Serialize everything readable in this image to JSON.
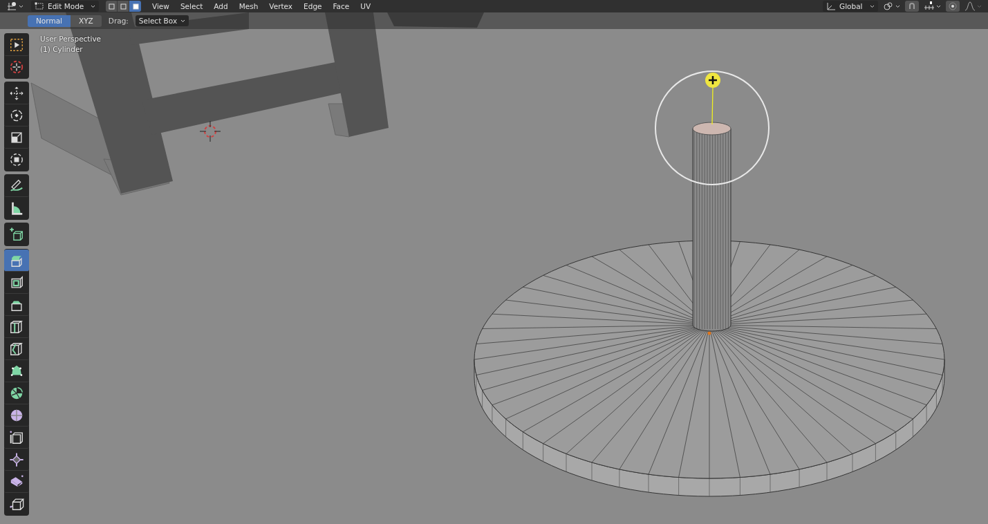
{
  "header": {
    "mode": "Edit Mode",
    "select_modes": [
      {
        "selected": false
      },
      {
        "selected": false
      },
      {
        "selected": true
      }
    ],
    "menus": [
      "View",
      "Select",
      "Add",
      "Mesh",
      "Vertex",
      "Edge",
      "Face",
      "UV"
    ],
    "orientation": "Global"
  },
  "tool_header": {
    "orientation_tabs": [
      {
        "label": "Normal",
        "selected": true
      },
      {
        "label": "XYZ",
        "selected": false
      }
    ],
    "drag_label": "Drag:",
    "drag_value": "Select Box"
  },
  "viewport": {
    "view_name": "User Perspective",
    "object_name": "(1) Cylinder"
  },
  "toolbar": [
    {
      "tools": [
        {
          "selected": false
        },
        {
          "selected": false
        }
      ]
    },
    {
      "tools": [
        {
          "selected": false
        },
        {
          "selected": false
        },
        {
          "selected": false
        },
        {
          "selected": false
        }
      ]
    },
    {
      "tools": [
        {
          "selected": false
        },
        {
          "selected": false
        }
      ]
    },
    {
      "tools": [
        {
          "selected": false
        }
      ]
    },
    {
      "tools": [
        {
          "selected": true
        },
        {
          "selected": false
        },
        {
          "selected": false
        },
        {
          "selected": false
        },
        {
          "selected": false
        },
        {
          "selected": false
        },
        {
          "selected": false
        },
        {
          "selected": false
        },
        {
          "selected": false
        },
        {
          "selected": false
        },
        {
          "selected": false
        },
        {
          "selected": false
        }
      ]
    }
  ]
}
